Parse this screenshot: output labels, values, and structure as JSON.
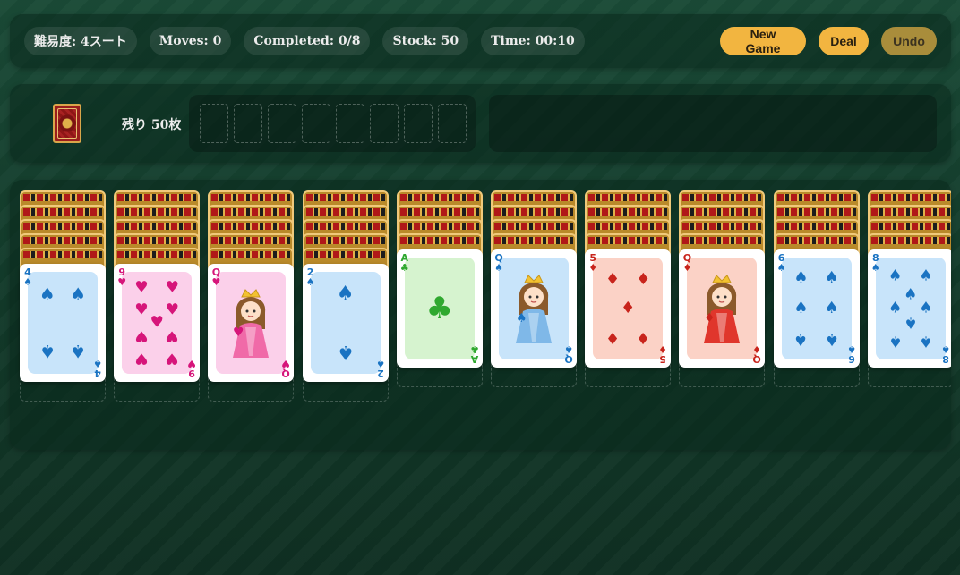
{
  "header": {
    "difficulty": "難易度: 4スート",
    "moves": "Moves: 0",
    "completed": "Completed: 0/8",
    "stock": "Stock: 50",
    "time": "Time: 00:10",
    "new_game_label": "New Game",
    "deal_label": "Deal",
    "undo_label": "Undo"
  },
  "stock_area": {
    "remaining_label": "残り 50枚",
    "foundation_slots": 8
  },
  "colors": {
    "spade": "#1a73c2",
    "heart": "#d6157a",
    "club": "#2fa82f",
    "diamond": "#c8241c",
    "button": "#f2b540"
  },
  "tableau": [
    {
      "hidden": 5,
      "top": {
        "rank": "4",
        "suit": "spade"
      }
    },
    {
      "hidden": 5,
      "top": {
        "rank": "9",
        "suit": "heart"
      }
    },
    {
      "hidden": 5,
      "top": {
        "rank": "Q",
        "suit": "heart"
      }
    },
    {
      "hidden": 5,
      "top": {
        "rank": "2",
        "suit": "spade"
      }
    },
    {
      "hidden": 4,
      "top": {
        "rank": "A",
        "suit": "club"
      }
    },
    {
      "hidden": 4,
      "top": {
        "rank": "Q",
        "suit": "spade"
      }
    },
    {
      "hidden": 4,
      "top": {
        "rank": "5",
        "suit": "diamond"
      }
    },
    {
      "hidden": 4,
      "top": {
        "rank": "Q",
        "suit": "diamond"
      }
    },
    {
      "hidden": 4,
      "top": {
        "rank": "6",
        "suit": "spade"
      }
    },
    {
      "hidden": 4,
      "top": {
        "rank": "8",
        "suit": "spade"
      }
    }
  ]
}
